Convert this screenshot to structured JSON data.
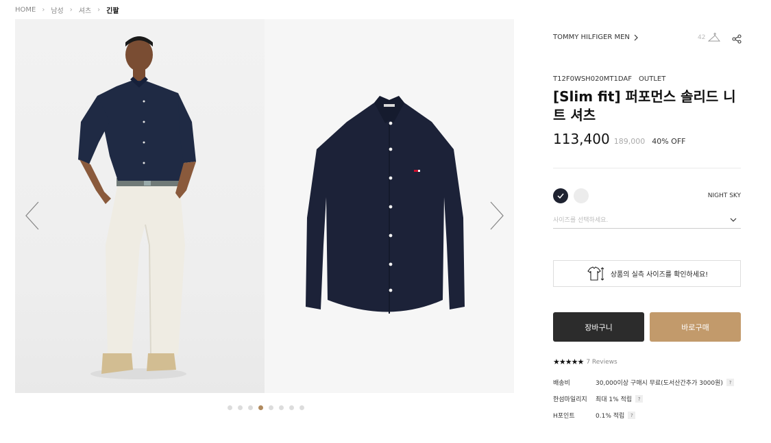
{
  "breadcrumb": [
    "HOME",
    "남성",
    "셔츠",
    "긴팔"
  ],
  "product": {
    "brand": "TOMMY HILFIGER MEN",
    "like_count": "42",
    "code": "T12F0WSH020MT1DAF",
    "tag": "OUTLET",
    "title": "[Slim fit] 퍼포먼스 솔리드 니트 셔츠",
    "price": "113,400",
    "original_price": "189,000",
    "discount": "40% OFF",
    "color_name": "NIGHT SKY",
    "size_placeholder": "사이즈를 선택하세요.",
    "fit_check": "상품의 실측 사이즈를 확인하세요!",
    "cart_label": "장바구니",
    "buy_label": "바로구매",
    "stars": "★★★★★",
    "reviews": "7 Reviews"
  },
  "details": [
    {
      "label": "배송비",
      "value": "30,000이상 구매시 무료(도서산간추가 3000원)",
      "help": "?"
    },
    {
      "label": "한섬마일리지",
      "value": "최대 1% 적립",
      "help": "?"
    },
    {
      "label": "H포인트",
      "value": "0.1% 적립",
      "help": "?"
    }
  ],
  "gallery": {
    "slide_count": 8,
    "active_slide": 4
  },
  "colors": {
    "accent": "#c29a6b",
    "dark": "#2c2c2c",
    "swatch_navy": "#1e2230",
    "swatch_white": "#ececec"
  },
  "icons": [
    "chevron-right-icon",
    "hanger-icon",
    "share-icon",
    "check-icon",
    "chevron-down-icon",
    "shirt-measure-icon",
    "arrow-left-icon",
    "arrow-right-icon"
  ]
}
